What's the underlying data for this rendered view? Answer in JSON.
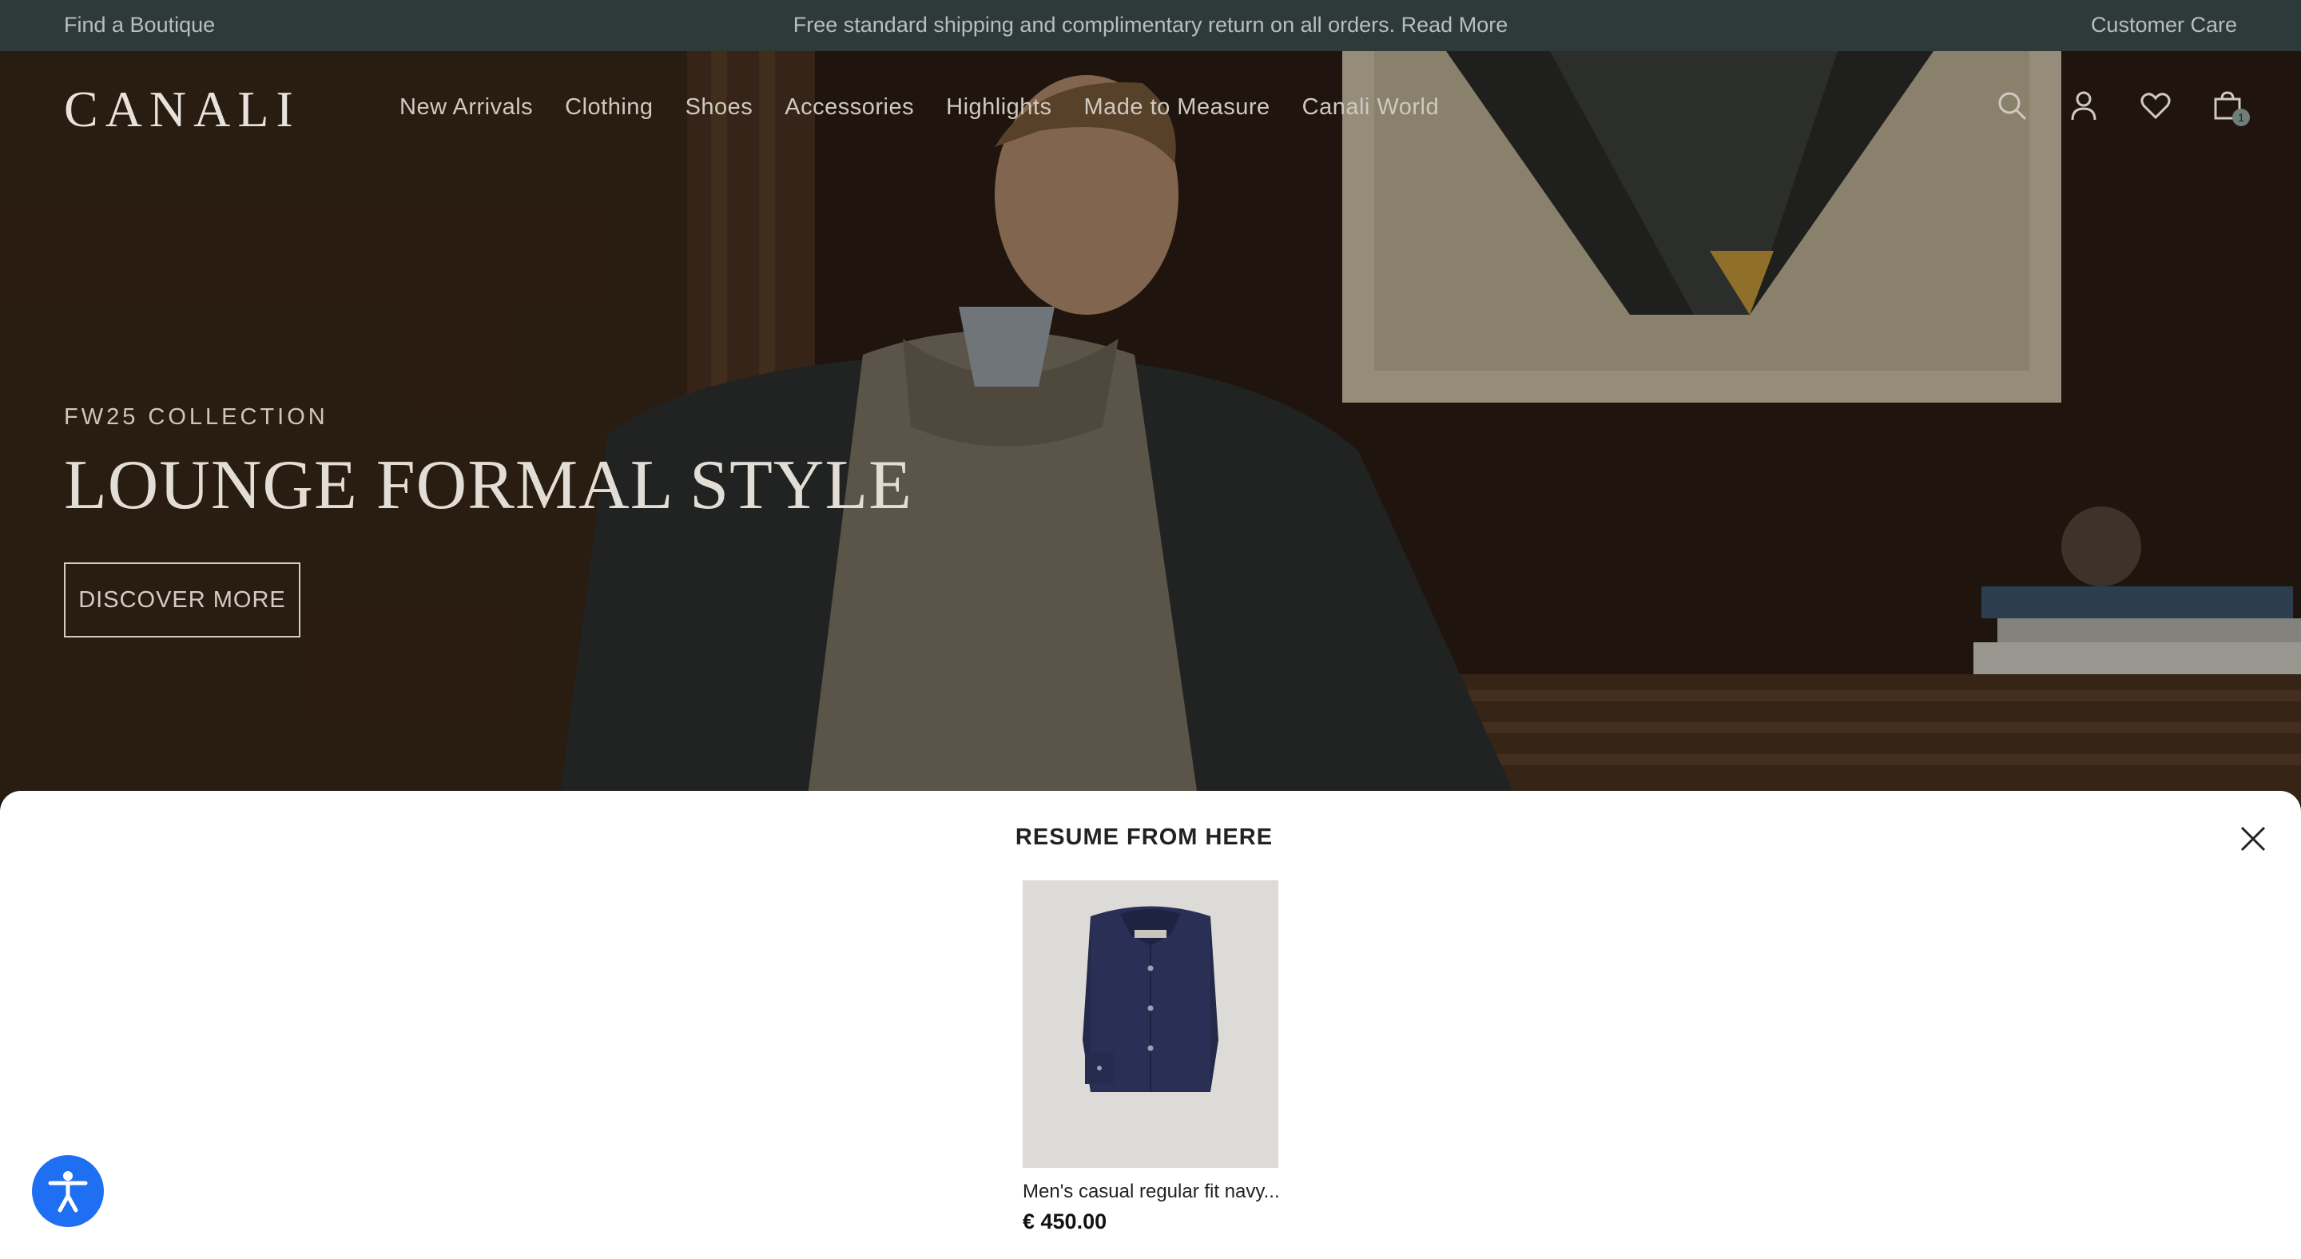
{
  "topbar": {
    "find_boutique": "Find a Boutique",
    "shipping_notice": "Free standard shipping and complimentary return on all orders.",
    "read_more": "Read More",
    "customer_care": "Customer Care"
  },
  "header": {
    "logo": "CANALI",
    "nav": [
      "New Arrivals",
      "Clothing",
      "Shoes",
      "Accessories",
      "Highlights",
      "Made to Measure",
      "Canali World"
    ],
    "bag_count": "1",
    "icons": [
      "search-icon",
      "account-icon",
      "wishlist-heart-icon",
      "shopping-bag-icon"
    ]
  },
  "hero": {
    "eyebrow": "FW25 COLLECTION",
    "headline": "LOUNGE FORMAL STYLE",
    "cta": "DISCOVER MORE"
  },
  "resume": {
    "title": "RESUME FROM HERE",
    "product": {
      "name": "Men's casual regular fit navy...",
      "price": "€ 450.00"
    }
  },
  "accessibility": {
    "icon": "accessibility-icon",
    "color": "#1f6ff2"
  }
}
